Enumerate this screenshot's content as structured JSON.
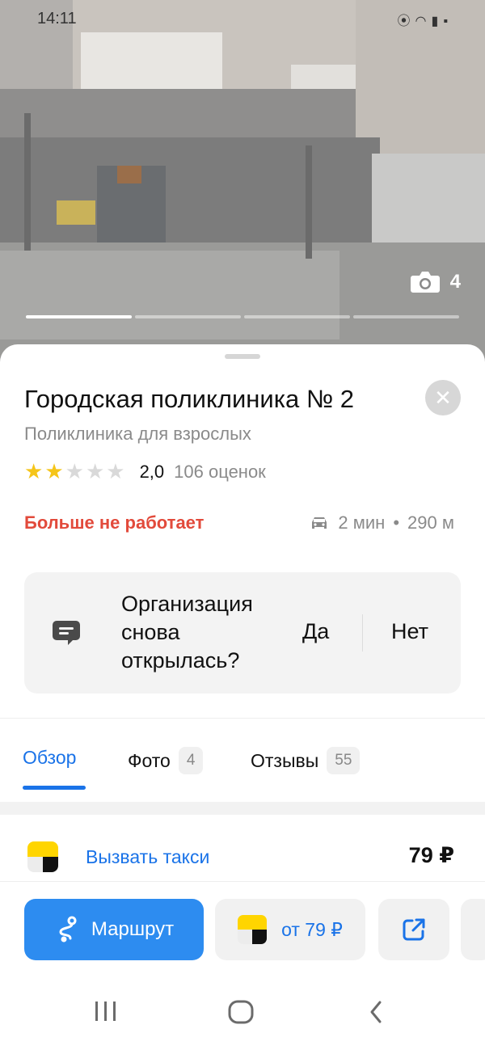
{
  "status_bar": {
    "time": "14:11"
  },
  "gallery": {
    "photo_count": "4"
  },
  "place": {
    "title": "Городская поликлиника № 2",
    "category": "Поликлиника для взрослых",
    "rating_value": "2,0",
    "stars_filled": 2,
    "stars_total": 5,
    "rating_count": "106 оценок",
    "status": "Больше не работает",
    "travel_time": "2 мин",
    "distance": "290 м"
  },
  "question_card": {
    "question": "Организация снова открылась?",
    "yes_label": "Да",
    "no_label": "Нет"
  },
  "tabs": [
    {
      "label": "Обзор",
      "badge": ""
    },
    {
      "label": "Фото",
      "badge": "4"
    },
    {
      "label": "Отзывы",
      "badge": "55"
    }
  ],
  "taxi": {
    "label": "Вызвать такси",
    "price": "79 ₽"
  },
  "actions": {
    "route_label": "Маршрут",
    "taxi_label": "от 79 ₽"
  },
  "colors": {
    "accent": "#2d8cf0",
    "link": "#1a73e8",
    "danger": "#e24a3b",
    "star": "#f5c51a"
  }
}
